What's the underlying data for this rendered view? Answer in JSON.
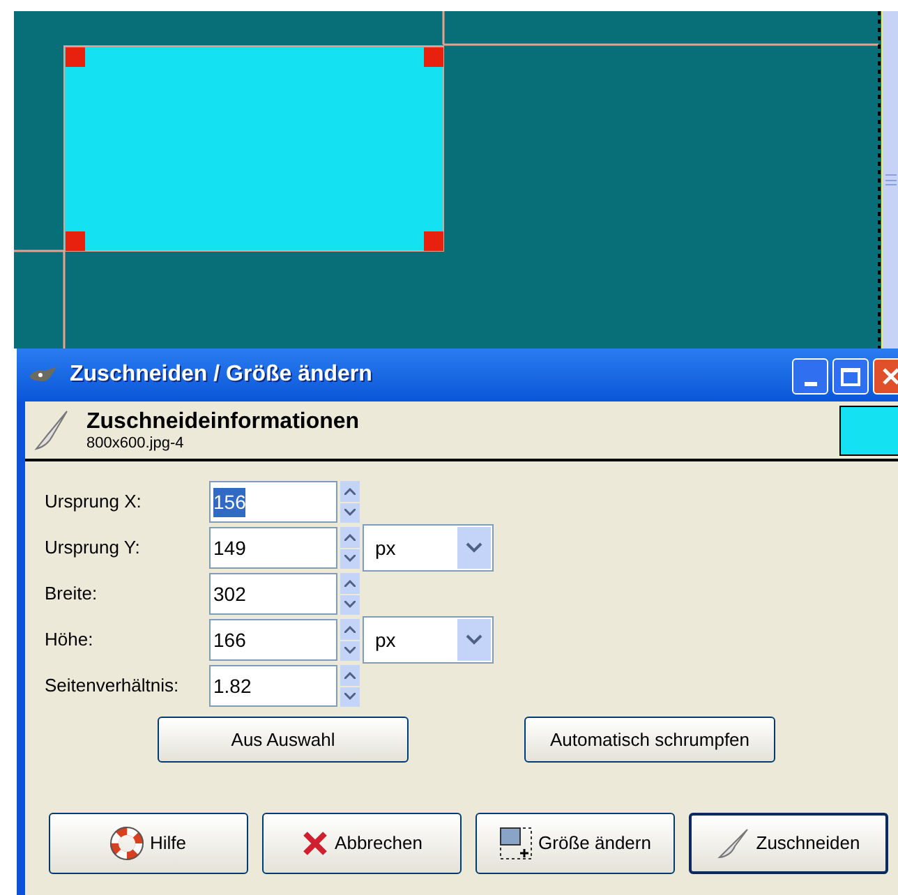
{
  "window": {
    "title": "Zuschneiden / Größe ändern"
  },
  "header": {
    "title": "Zuschneideinformationen",
    "subtitle": "800x600.jpg-4"
  },
  "fields": [
    {
      "label": "Ursprung X:",
      "value": "156",
      "text_selected": true
    },
    {
      "label": "Ursprung Y:",
      "value": "149",
      "text_selected": false,
      "unit": "px"
    },
    {
      "label": "Breite:",
      "value": "302",
      "text_selected": false
    },
    {
      "label": "Höhe:",
      "value": "166",
      "text_selected": false,
      "unit": "px"
    },
    {
      "label": "Seitenverhältnis:",
      "value": "1.82",
      "text_selected": false
    }
  ],
  "actions": [
    "Aus Auswahl",
    "Automatisch schrumpfen"
  ],
  "buttons": [
    {
      "label": "Hilfe",
      "kind": "help",
      "default": false
    },
    {
      "label": "Abbrechen",
      "kind": "cancel",
      "default": false
    },
    {
      "label": "Größe ändern",
      "kind": "resize",
      "default": false
    },
    {
      "label": "Zuschneiden",
      "kind": "crop",
      "default": true
    }
  ]
}
